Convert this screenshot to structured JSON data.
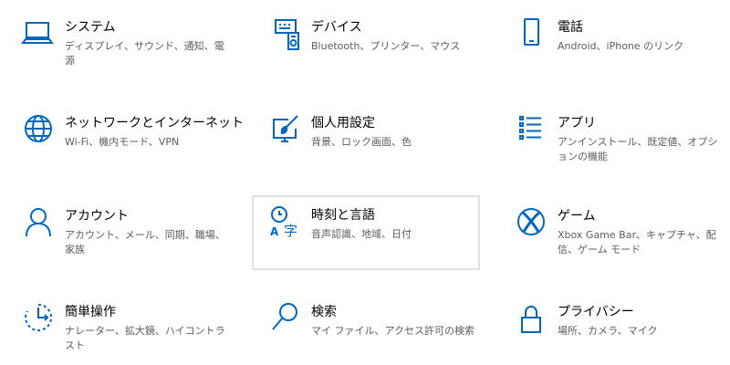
{
  "accent": "#0067c0",
  "tiles": [
    {
      "title": "システム",
      "desc": "ディスプレイ、サウンド、通知、電源",
      "icon": "laptop-icon"
    },
    {
      "title": "デバイス",
      "desc": "Bluetooth、プリンター、マウス",
      "icon": "devices-icon"
    },
    {
      "title": "電話",
      "desc": "Android、iPhone のリンク",
      "icon": "phone-icon"
    },
    {
      "title": "ネットワークとインターネット",
      "desc": "Wi-Fi、機内モード、VPN",
      "icon": "globe-icon"
    },
    {
      "title": "個人用設定",
      "desc": "背景、ロック画面、色",
      "icon": "personalization-icon"
    },
    {
      "title": "アプリ",
      "desc": "アンインストール、既定値、オプションの機能",
      "icon": "apps-list-icon"
    },
    {
      "title": "アカウント",
      "desc": "アカウント、メール、同期、職場、家族",
      "icon": "person-icon"
    },
    {
      "title": "時刻と言語",
      "desc": "音声認識、地域、日付",
      "icon": "time-language-icon"
    },
    {
      "title": "ゲーム",
      "desc": "Xbox Game Bar、キャプチャ、配信、ゲーム モード",
      "icon": "xbox-icon"
    },
    {
      "title": "簡単操作",
      "desc": "ナレーター、拡大鏡、ハイコントラスト",
      "icon": "ease-of-access-icon"
    },
    {
      "title": "検索",
      "desc": "マイ ファイル、アクセス許可の検索",
      "icon": "search-icon"
    },
    {
      "title": "プライバシー",
      "desc": "場所、カメラ、マイク",
      "icon": "lock-icon"
    }
  ]
}
